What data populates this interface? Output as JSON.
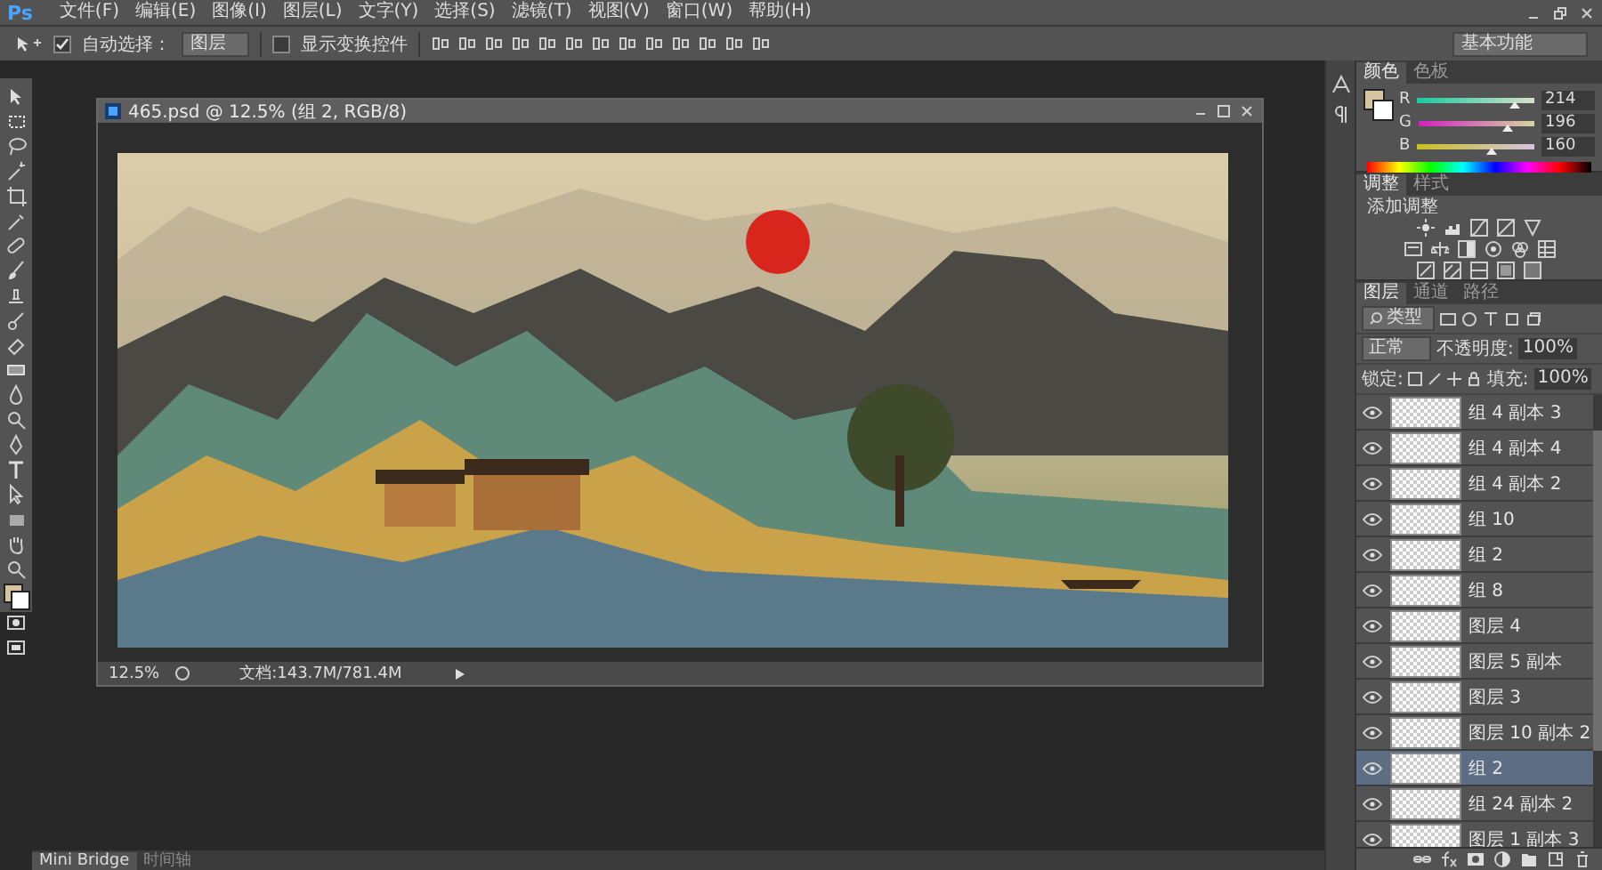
{
  "app": {
    "logo": "Ps"
  },
  "menu": [
    "文件(F)",
    "编辑(E)",
    "图像(I)",
    "图层(L)",
    "文字(Y)",
    "选择(S)",
    "滤镜(T)",
    "视图(V)",
    "窗口(W)",
    "帮助(H)"
  ],
  "options_bar": {
    "auto_select": {
      "label": "自动选择：",
      "checked": true
    },
    "auto_select_target": "图层",
    "show_transform": {
      "label": "显示变换控件",
      "checked": false
    },
    "workspace": "基本功能"
  },
  "document": {
    "title": "465.psd @ 12.5% (组 2, RGB/8)",
    "zoom": "12.5%",
    "doc_info": "文档:143.7M/781.4M"
  },
  "color_panel": {
    "tabs": [
      {
        "label": "颜色",
        "selected": true
      },
      {
        "label": "色板",
        "selected": false
      }
    ],
    "channels": [
      {
        "name": "R",
        "value": "214",
        "level": 0.84
      },
      {
        "name": "G",
        "value": "196",
        "level": 0.77
      },
      {
        "name": "B",
        "value": "160",
        "level": 0.63
      }
    ]
  },
  "adjustments_panel": {
    "tabs": [
      {
        "label": "调整",
        "selected": true
      },
      {
        "label": "样式",
        "selected": false
      }
    ],
    "heading": "添加调整"
  },
  "layers_panel": {
    "tabs": [
      {
        "label": "图层",
        "selected": true
      },
      {
        "label": "通道",
        "selected": false
      },
      {
        "label": "路径",
        "selected": false
      }
    ],
    "filter": "类型",
    "blend_mode": "正常",
    "opacity_label": "不透明度:",
    "opacity": "100%",
    "lock_label": "锁定:",
    "fill_label": "填充:",
    "fill": "100%",
    "layers": [
      {
        "name": "组 4 副本 3",
        "visible": true,
        "selected": false
      },
      {
        "name": "组 4 副本 4",
        "visible": true,
        "selected": false
      },
      {
        "name": "组 4 副本 2",
        "visible": true,
        "selected": false
      },
      {
        "name": "组 10",
        "visible": true,
        "selected": false
      },
      {
        "name": "组 2",
        "visible": true,
        "selected": false
      },
      {
        "name": "组 8",
        "visible": true,
        "selected": false
      },
      {
        "name": "图层 4",
        "visible": true,
        "selected": false
      },
      {
        "name": "图层 5 副本",
        "visible": true,
        "selected": false
      },
      {
        "name": "图层 3",
        "visible": true,
        "selected": false
      },
      {
        "name": "图层 10 副本 2",
        "visible": true,
        "selected": false
      },
      {
        "name": "组 2",
        "visible": true,
        "selected": true
      },
      {
        "name": "组 24 副本 2",
        "visible": true,
        "selected": false
      },
      {
        "name": "图层 1 副本 3",
        "visible": true,
        "selected": false
      }
    ]
  },
  "bottom_tabs": [
    {
      "label": "Mini Bridge",
      "selected": true
    },
    {
      "label": "时间轴",
      "selected": false
    }
  ]
}
